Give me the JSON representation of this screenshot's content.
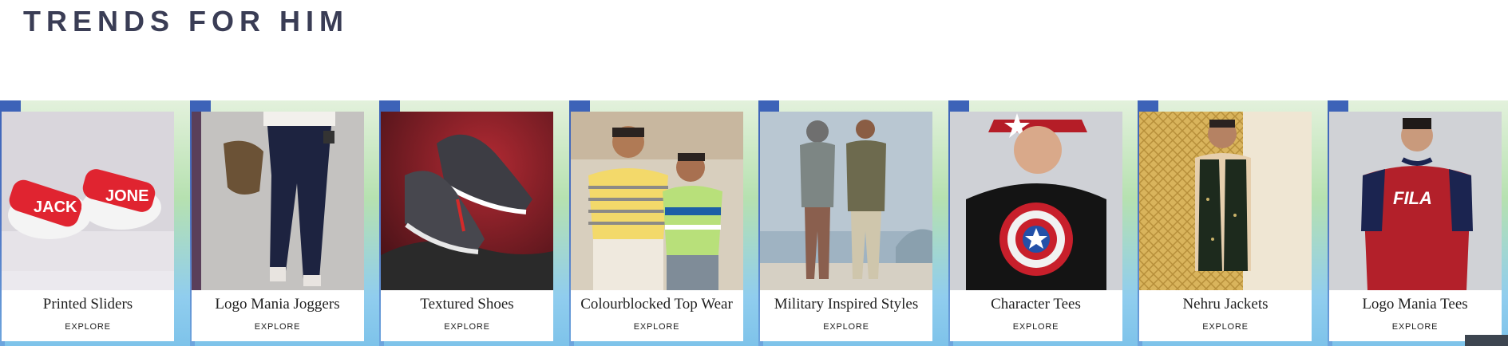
{
  "section": {
    "title": "TRENDS FOR HIM"
  },
  "tiles": [
    {
      "label": "Printed Sliders",
      "cta": "EXPLORE",
      "icon": "sliders-photo"
    },
    {
      "label": "Logo Mania Joggers",
      "cta": "EXPLORE",
      "icon": "joggers-photo"
    },
    {
      "label": "Textured Shoes",
      "cta": "EXPLORE",
      "icon": "shoes-photo"
    },
    {
      "label": "Colourblocked Top Wear",
      "cta": "EXPLORE",
      "icon": "topwear-photo"
    },
    {
      "label": "Military Inspired Styles",
      "cta": "EXPLORE",
      "icon": "military-photo"
    },
    {
      "label": "Character Tees",
      "cta": "EXPLORE",
      "icon": "character-tee-photo"
    },
    {
      "label": "Nehru Jackets",
      "cta": "EXPLORE",
      "icon": "nehru-jacket-photo"
    },
    {
      "label": "Logo Mania Tees",
      "cta": "EXPLORE",
      "icon": "logo-tee-photo"
    }
  ],
  "brand_text": {
    "slider_left": "JACK",
    "slider_right": "JONE",
    "tee_logo": "FILA"
  },
  "colors": {
    "title": "#3a3d55",
    "accent_blue": "#3d63b8",
    "slider_red": "#e02430",
    "tee_red": "#b3202a"
  }
}
